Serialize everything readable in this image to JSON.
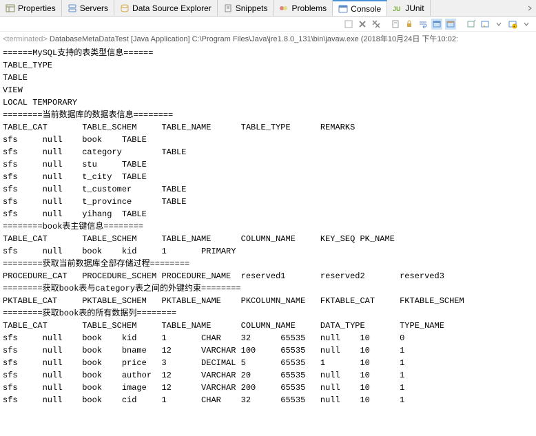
{
  "tabs": [
    {
      "label": "Properties",
      "icon": "properties-icon"
    },
    {
      "label": "Servers",
      "icon": "servers-icon"
    },
    {
      "label": "Data Source Explorer",
      "icon": "data-source-icon"
    },
    {
      "label": "Snippets",
      "icon": "snippets-icon"
    },
    {
      "label": "Problems",
      "icon": "problems-icon"
    },
    {
      "label": "Console",
      "icon": "console-icon",
      "active": true
    },
    {
      "label": "JUnit",
      "icon": "junit-icon"
    }
  ],
  "meta": {
    "terminated": "<terminated>",
    "process": "DatabaseMetaDataTest [Java Application] C:\\Program Files\\Java\\jre1.8.0_131\\bin\\javaw.exe (2018年10月24日 下午10:02:"
  },
  "console_output": "======MySQL支持的表类型信息======\nTABLE_TYPE\nTABLE\nVIEW\nLOCAL TEMPORARY\n========当前数据库的数据表信息========\nTABLE_CAT       TABLE_SCHEM     TABLE_NAME      TABLE_TYPE      REMARKS\nsfs     null    book    TABLE\nsfs     null    category        TABLE\nsfs     null    stu     TABLE\nsfs     null    t_city  TABLE\nsfs     null    t_customer      TABLE\nsfs     null    t_province      TABLE\nsfs     null    yihang  TABLE\n========book表主键信息========\nTABLE_CAT       TABLE_SCHEM     TABLE_NAME      COLUMN_NAME     KEY_SEQ PK_NAME\nsfs     null    book    kid     1       PRIMARY\n========获取当前数据库全部存储过程========\nPROCEDURE_CAT   PROCEDURE_SCHEM PROCEDURE_NAME  reserved1       reserved2       reserved3\n========获取book表与category表之间的外键约束========\nPKTABLE_CAT     PKTABLE_SCHEM   PKTABLE_NAME    PKCOLUMN_NAME   FKTABLE_CAT     FKTABLE_SCHEM\n========获取book表的所有数据列========\nTABLE_CAT       TABLE_SCHEM     TABLE_NAME      COLUMN_NAME     DATA_TYPE       TYPE_NAME\nsfs     null    book    kid     1       CHAR    32      65535   null    10      0\nsfs     null    book    bname   12      VARCHAR 100     65535   null    10      1\nsfs     null    book    price   3       DECIMAL 5       65535   1       10      1\nsfs     null    book    author  12      VARCHAR 20      65535   null    10      1\nsfs     null    book    image   12      VARCHAR 200     65535   null    10      1\nsfs     null    book    cid     1       CHAR    32      65535   null    10      1"
}
